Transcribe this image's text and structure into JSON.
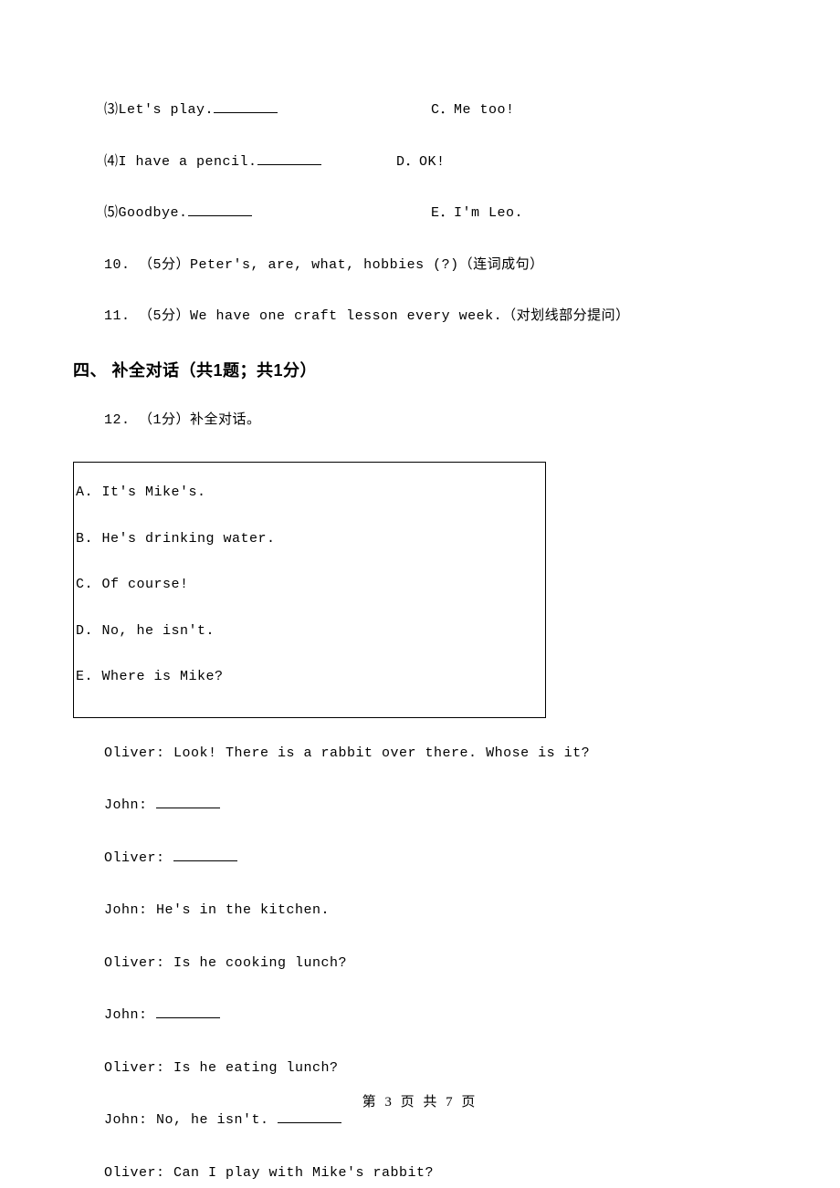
{
  "matches": {
    "row3": {
      "left_prefix": "⑶",
      "left_text": "Let's play.",
      "right_label": "C．",
      "right_text": "Me too!"
    },
    "row4": {
      "left_prefix": "⑷",
      "left_text": "I have a pencil.",
      "right_label": "D．",
      "right_text": "OK!"
    },
    "row5": {
      "left_prefix": "⑸",
      "left_text": "Goodbye.",
      "right_label": "E．",
      "right_text": "I'm Leo."
    }
  },
  "q10": {
    "num": "10.",
    "points": "（5分）",
    "text": "Peter's, are, what, hobbies (?)（连词成句）"
  },
  "q11": {
    "num": "11.",
    "points": "（5分）",
    "text": "We have one craft lesson every week.（对划线部分提问）"
  },
  "section4": "四、 补全对话（共1题；共1分）",
  "q12": {
    "num": "12.",
    "points": "（1分）",
    "text": "补全对话。"
  },
  "options": {
    "a": "A. It's Mike's.",
    "b": "B. He's drinking water.",
    "c": "C. Of course!",
    "d": "D. No, he isn't.",
    "e": "E. Where is Mike?"
  },
  "dialog": {
    "line1": "Oliver: Look! There is a rabbit over there. Whose is it?",
    "line2": "John: ",
    "line3": "Oliver: ",
    "line4": "John: He's in the kitchen.",
    "line5": "Oliver: Is he cooking lunch?",
    "line6": "John: ",
    "line7": "Oliver: Is he eating lunch?",
    "line8_pre": "John: No, he isn't. ",
    "line9": "Oliver: Can I play with Mike's rabbit?"
  },
  "footer": "第 3 页 共 7 页"
}
